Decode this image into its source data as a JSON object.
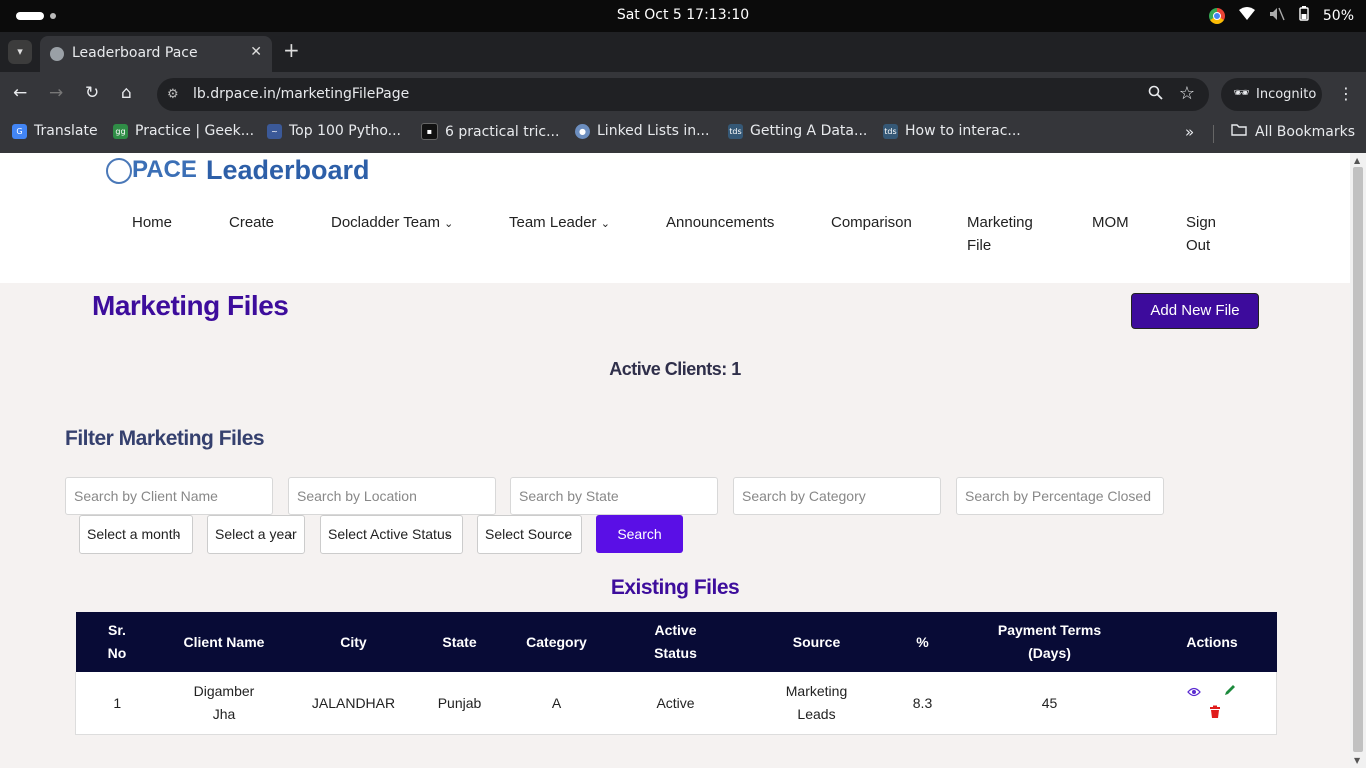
{
  "os": {
    "datetime": "Sat Oct 5  17:13:10",
    "battery": "50%"
  },
  "browser": {
    "tab_title": "Leaderboard Pace",
    "url": "lb.drpace.in/marketingFilePage",
    "incognito_label": "Incognito",
    "bookmarks": [
      {
        "label": "Translate",
        "color": "#4285f4"
      },
      {
        "label": "Practice | Geek...",
        "color": "#2f8d46"
      },
      {
        "label": "Top 100 Pytho...",
        "color": "#3b5998"
      },
      {
        "label": "6 practical tric...",
        "color": "#111111"
      },
      {
        "label": "Linked Lists in...",
        "color": "#6c8ebf"
      },
      {
        "label": "Getting A Data...",
        "color": "#355876"
      },
      {
        "label": "How to interac...",
        "color": "#355876"
      }
    ],
    "all_bookmarks": "All Bookmarks"
  },
  "site": {
    "logo_text": "PACE",
    "brand": "Leaderboard",
    "nav": [
      {
        "label": "Home"
      },
      {
        "label": "Create"
      },
      {
        "label": "Docladder Team"
      },
      {
        "label": "Team Leader"
      },
      {
        "label": "Announcements"
      },
      {
        "label": "Comparison"
      },
      {
        "label": "Marketing File"
      },
      {
        "label": "MOM"
      },
      {
        "label": "Sign Out"
      }
    ]
  },
  "main": {
    "title": "Marketing Files",
    "add_button": "Add New File",
    "active_clients": "Active Clients: 1",
    "filter_title": "Filter Marketing Files",
    "filters": {
      "client_name": "Search by Client Name",
      "location": "Search by Location",
      "state": "Search by State",
      "category": "Search by Category",
      "percentage": "Search by Percentage Closed"
    },
    "selects": {
      "month": "Select a month",
      "year": "Select a year",
      "active_status": "Select Active Status",
      "source": "Select Source"
    },
    "search_button": "Search",
    "existing_title": "Existing Files",
    "table": {
      "headers": [
        "Sr. No",
        "Client Name",
        "City",
        "State",
        "Category",
        "Active Status",
        "Source",
        "%",
        "Payment Terms (Days)",
        "Actions"
      ],
      "rows": [
        [
          "1",
          "Digamber Jha",
          "JALANDHAR",
          "Punjab",
          "A",
          "Active",
          "Marketing Leads",
          "8.3",
          "45"
        ]
      ]
    }
  }
}
